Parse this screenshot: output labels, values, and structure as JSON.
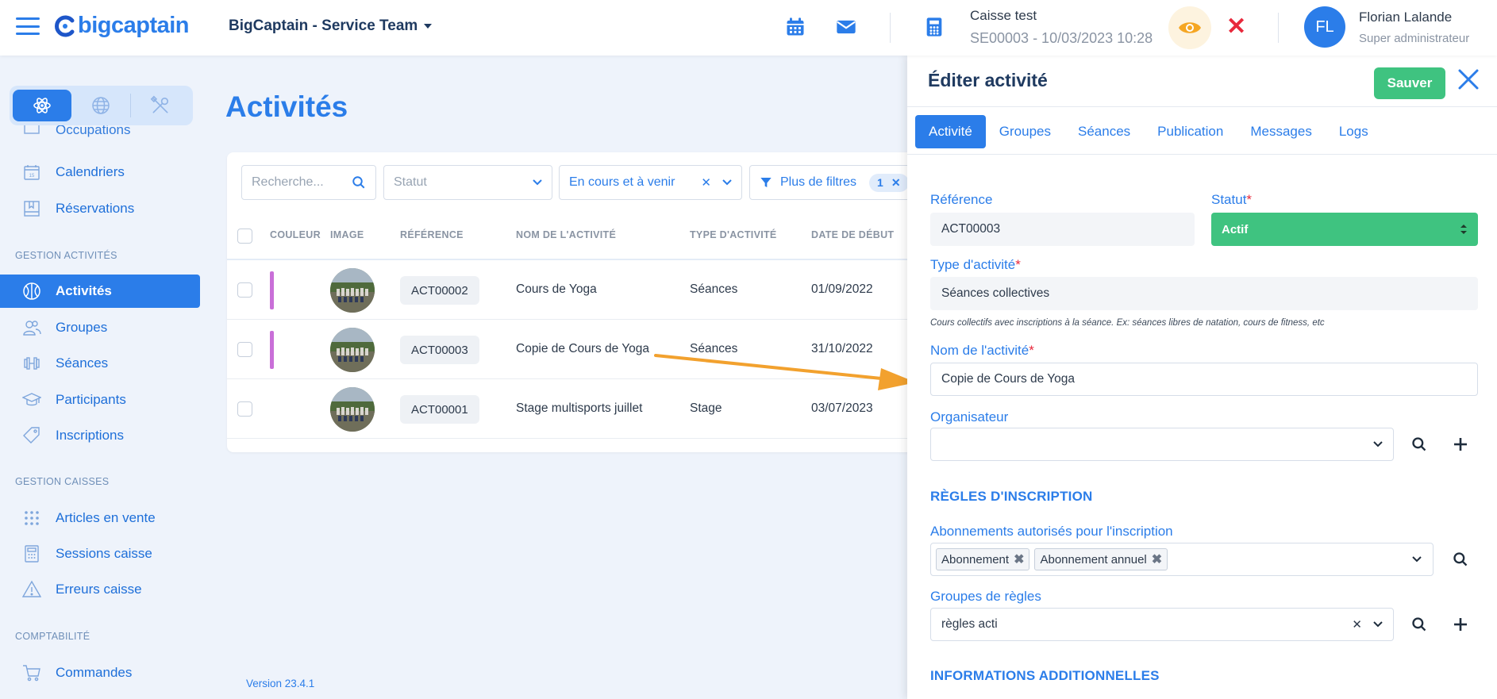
{
  "header": {
    "logo": "bigcaptain",
    "team": "BigCaptain - Service Team",
    "caisse_title": "Caisse test",
    "caisse_session": "SE00003 - 10/03/2023 10:28",
    "user_initials": "FL",
    "user_name": "Florian Lalande",
    "user_role": "Super administrateur"
  },
  "sidebar": {
    "partial_item": "Occupations",
    "items_top": [
      {
        "label": "Calendriers",
        "icon": "calendar-icon"
      },
      {
        "label": "Réservations",
        "icon": "book-icon"
      }
    ],
    "section_activites": "GESTION ACTIVITÉS",
    "items_activites": [
      {
        "label": "Activités",
        "icon": "ball-icon",
        "active": true
      },
      {
        "label": "Groupes",
        "icon": "users-icon"
      },
      {
        "label": "Séances",
        "icon": "dumbbell-icon"
      },
      {
        "label": "Participants",
        "icon": "graduation-icon"
      },
      {
        "label": "Inscriptions",
        "icon": "tag-icon"
      }
    ],
    "section_caisses": "GESTION CAISSES",
    "items_caisses": [
      {
        "label": "Articles en vente",
        "icon": "grid-dots-icon"
      },
      {
        "label": "Sessions caisse",
        "icon": "calculator-icon"
      },
      {
        "label": "Erreurs caisse",
        "icon": "warning-icon"
      }
    ],
    "section_compta": "COMPTABILITÉ",
    "items_compta": [
      {
        "label": "Commandes",
        "icon": "cart-icon"
      }
    ],
    "version": "Version 23.4.1"
  },
  "main": {
    "title": "Activités",
    "filters": {
      "search_placeholder": "Recherche...",
      "statut_placeholder": "Statut",
      "period_value": "En cours et à venir",
      "more_filters": "Plus de filtres",
      "more_filters_count": "1"
    },
    "columns": [
      "COULEUR",
      "IMAGE",
      "RÉFÉRENCE",
      "NOM DE L'ACTIVITÉ",
      "TYPE D'ACTIVITÉ",
      "DATE DE DÉBUT"
    ],
    "rows": [
      {
        "ref": "ACT00002",
        "name": "Cours de Yoga",
        "type": "Séances",
        "start": "01/09/2022",
        "color": "#c96fd8"
      },
      {
        "ref": "ACT00003",
        "name": "Copie de Cours de Yoga",
        "type": "Séances",
        "start": "31/10/2022",
        "color": "#c96fd8"
      },
      {
        "ref": "ACT00001",
        "name": "Stage multisports juillet",
        "type": "Stage",
        "start": "03/07/2023",
        "color": ""
      }
    ]
  },
  "panel": {
    "title": "Éditer activité",
    "save": "Sauver",
    "tabs": [
      "Activité",
      "Groupes",
      "Séances",
      "Publication",
      "Messages",
      "Logs"
    ],
    "reference_label": "Référence",
    "reference_value": "ACT00003",
    "statut_label": "Statut",
    "statut_value": "Actif",
    "type_label": "Type d'activité",
    "type_value": "Séances collectives",
    "type_hint": "Cours collectifs avec inscriptions à la séance. Ex: séances libres de natation, cours de fitness, etc",
    "name_label": "Nom de l'activité",
    "name_value": "Copie de Cours de Yoga",
    "organisateur_label": "Organisateur",
    "section_rules": "RÈGLES D'INSCRIPTION",
    "abonnements_label": "Abonnements autorisés pour l'inscription",
    "abonnements_tags": [
      "Abonnement",
      "Abonnement annuel"
    ],
    "groupes_label": "Groupes de règles",
    "groupes_value": "règles acti",
    "section_info": "INFORMATIONS ADDITIONNELLES"
  },
  "colors": {
    "primary": "#2b7de9",
    "success": "#3fc380",
    "danger": "#e8283b",
    "arrow": "#f2a12e"
  }
}
